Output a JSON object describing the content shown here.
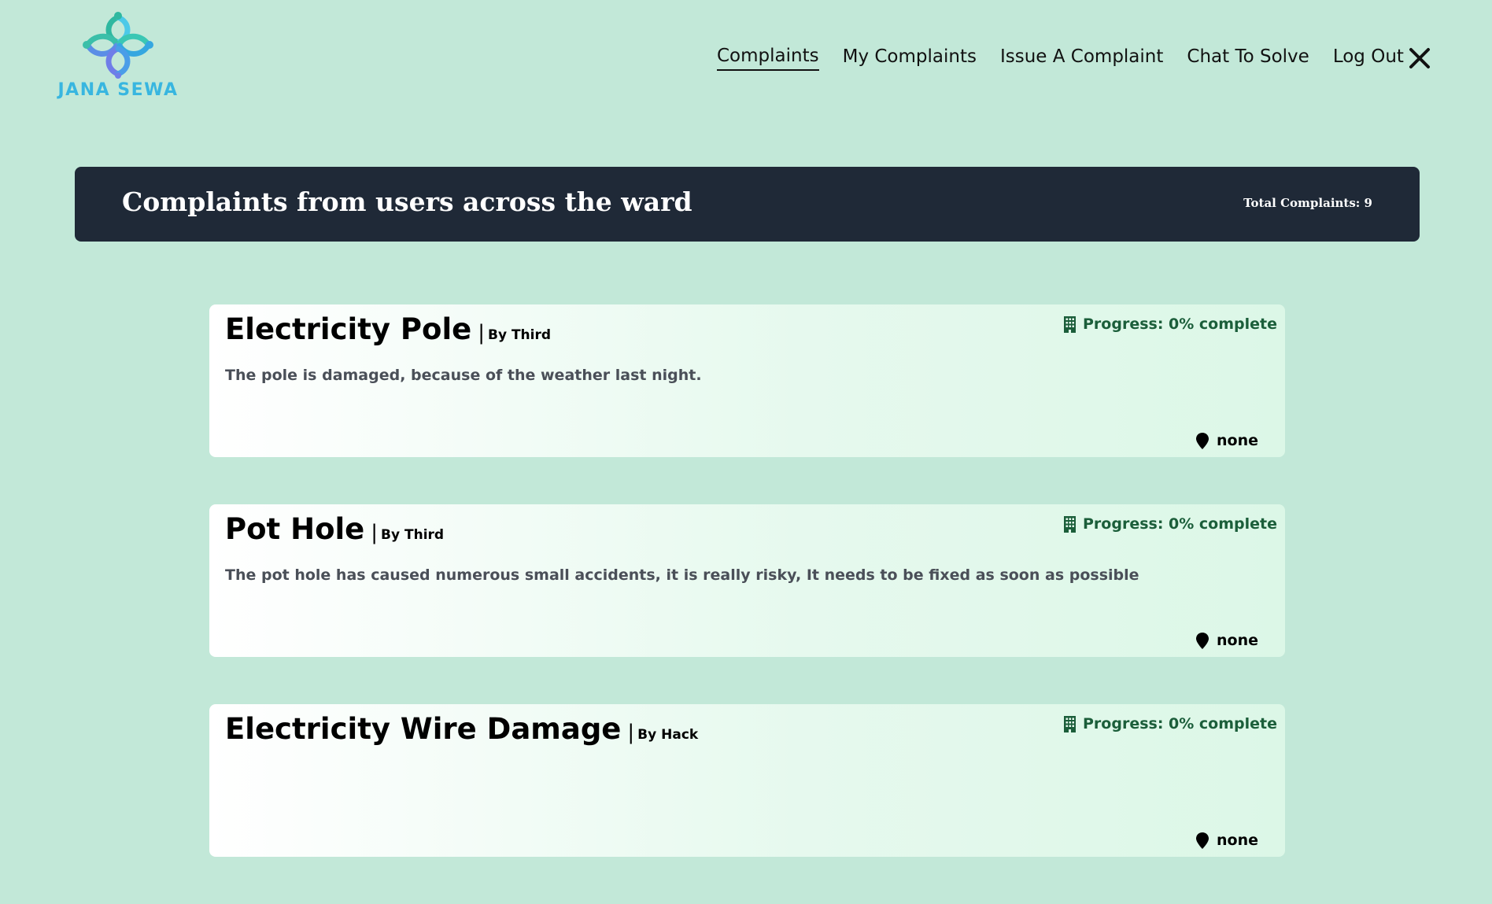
{
  "brand": {
    "name": "JANA SEWA"
  },
  "nav": {
    "items": [
      {
        "label": "Complaints",
        "active": true
      },
      {
        "label": "My Complaints",
        "active": false
      },
      {
        "label": "Issue A Complaint",
        "active": false
      },
      {
        "label": "Chat To Solve",
        "active": false
      },
      {
        "label": "Log Out",
        "active": false
      }
    ]
  },
  "banner": {
    "title": "Complaints from users across the ward",
    "total": "Total Complaints: 9"
  },
  "complaints": [
    {
      "title": "Electricity Pole",
      "sep": "|",
      "by": "By Third",
      "description": "The pole is damaged, because of the weather last night.",
      "progress": "Progress: 0% complete",
      "progress_value": 0,
      "location": "none"
    },
    {
      "title": "Pot Hole",
      "sep": "|",
      "by": "By Third",
      "description": "The pot hole has caused numerous small accidents, it is really risky, It needs to be fixed as soon as possible",
      "progress": "Progress: 0% complete",
      "progress_value": 0,
      "location": "none"
    },
    {
      "title": "Electricity Wire Damage",
      "sep": "|",
      "by": "By Hack",
      "description": "",
      "progress": "Progress: 0% complete",
      "progress_value": 0,
      "location": "none"
    }
  ],
  "icons": {
    "logo": "logo-icon",
    "close": "close-icon",
    "progress": "building-icon",
    "location": "map-pin-icon"
  },
  "colors": {
    "background": "#c2e8d8",
    "banner": "#1f2937",
    "brand_text": "#38b6e0",
    "progress_text": "#1b5e3a"
  }
}
